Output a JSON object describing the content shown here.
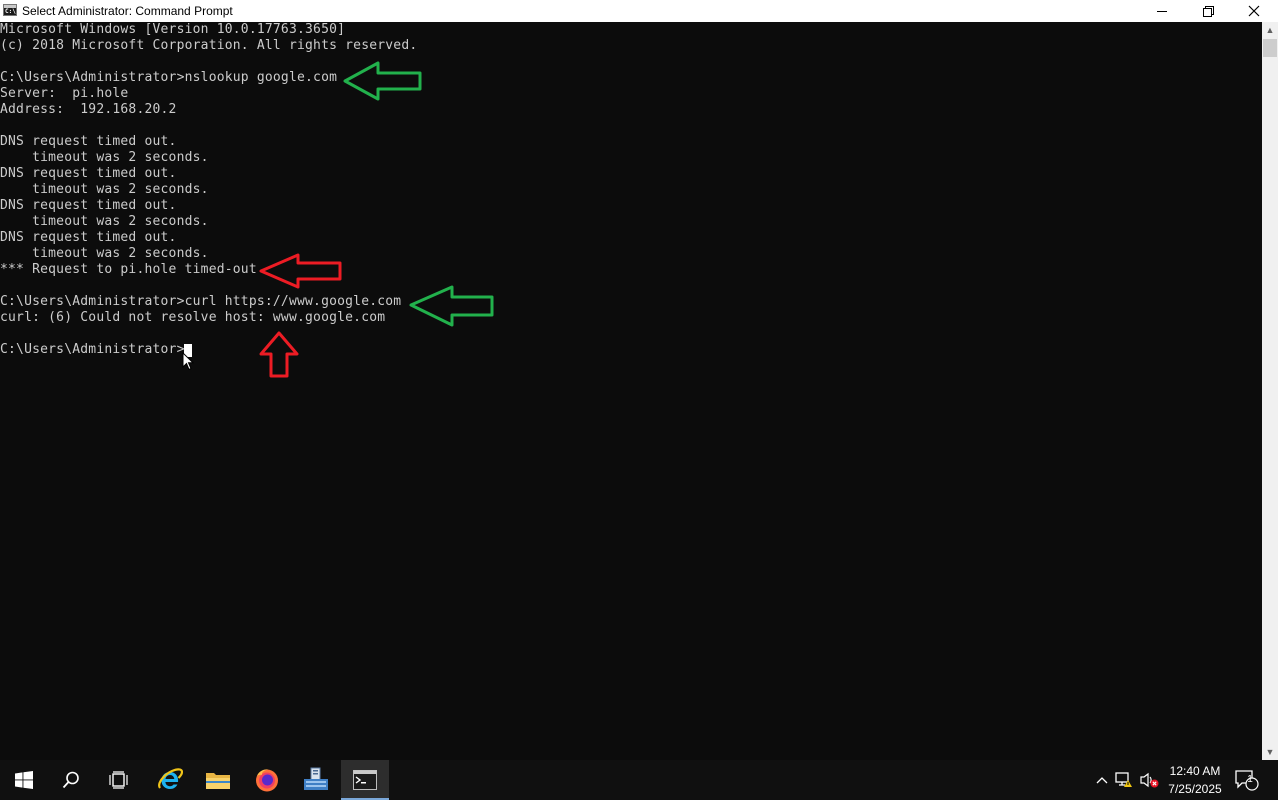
{
  "window": {
    "title": "Select Administrator: Command Prompt",
    "icon_label": "C:\\"
  },
  "console": {
    "lines": [
      "Microsoft Windows [Version 10.0.17763.3650]",
      "(c) 2018 Microsoft Corporation. All rights reserved.",
      "",
      "C:\\Users\\Administrator>nslookup google.com",
      "Server:  pi.hole",
      "Address:  192.168.20.2",
      "",
      "DNS request timed out.",
      "    timeout was 2 seconds.",
      "DNS request timed out.",
      "    timeout was 2 seconds.",
      "DNS request timed out.",
      "    timeout was 2 seconds.",
      "DNS request timed out.",
      "    timeout was 2 seconds.",
      "*** Request to pi.hole timed-out",
      "",
      "C:\\Users\\Administrator>curl https://www.google.com",
      "curl: (6) Could not resolve host: www.google.com",
      "",
      "C:\\Users\\Administrator>"
    ]
  },
  "annotations": {
    "arrow_colors": {
      "green": "#22b14c",
      "red": "#ed1c24"
    },
    "arrows": [
      {
        "name": "green-arrow-nslookup",
        "color": "green",
        "direction": "left"
      },
      {
        "name": "red-arrow-timeout",
        "color": "red",
        "direction": "left"
      },
      {
        "name": "green-arrow-curl",
        "color": "green",
        "direction": "left"
      },
      {
        "name": "red-arrow-resolve",
        "color": "red",
        "direction": "up"
      }
    ]
  },
  "taskbar": {
    "items": [
      {
        "name": "start-button",
        "icon": "windows-logo-icon"
      },
      {
        "name": "search-button",
        "icon": "search-icon"
      },
      {
        "name": "task-view-button",
        "icon": "task-view-icon"
      },
      {
        "name": "internet-explorer-button",
        "icon": "internet-explorer-icon"
      },
      {
        "name": "file-explorer-button",
        "icon": "folder-icon"
      },
      {
        "name": "firefox-button",
        "icon": "firefox-icon"
      },
      {
        "name": "server-manager-button",
        "icon": "server-manager-icon"
      },
      {
        "name": "command-prompt-button",
        "icon": "command-prompt-icon"
      }
    ],
    "tray": {
      "time": "12:40 AM",
      "date": "7/25/2025",
      "notification_count": "1"
    }
  }
}
